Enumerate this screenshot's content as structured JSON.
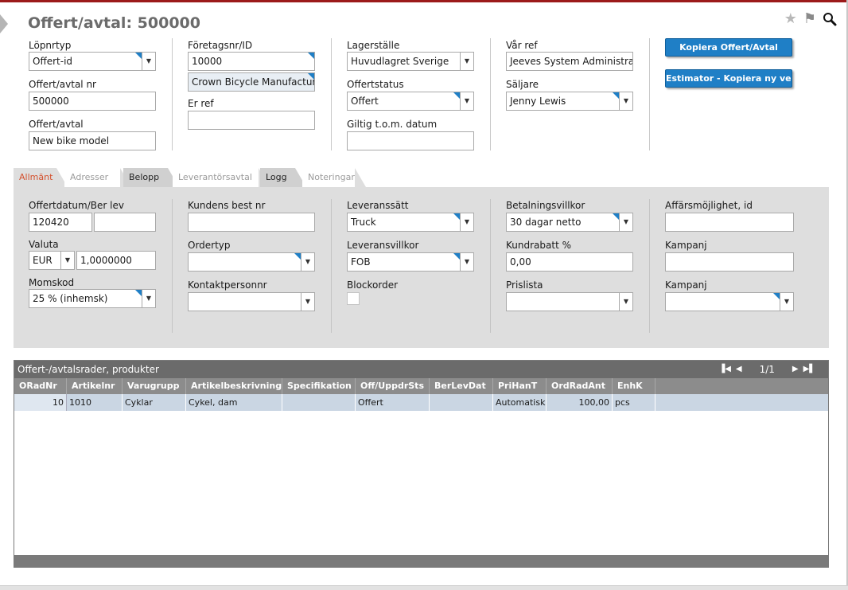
{
  "header": {
    "title": "Offert/avtal: 500000",
    "icons": [
      "star-icon",
      "flag-icon",
      "search-icon"
    ]
  },
  "top": {
    "lopnrtyp_label": "Löpnrtyp",
    "lopnrtyp_value": "Offert-id",
    "nr_label": "Offert/avtal nr",
    "nr_value": "500000",
    "offert_label": "Offert/avtal",
    "offert_value": "New bike model",
    "foretag_label": "Företagsnr/ID",
    "foretag_value": "10000",
    "foretag_name": "Crown Bicycle Manufacture",
    "erref_label": "Er ref",
    "erref_value": "",
    "lager_label": "Lagerställe",
    "lager_value": "Huvudlagret Sverige",
    "status_label": "Offertstatus",
    "status_value": "Offert",
    "giltig_label": "Giltig t.o.m. datum",
    "giltig_value": "",
    "varref_label": "Vår ref",
    "varref_value": "Jeeves System Administrato",
    "saljare_label": "Säljare",
    "saljare_value": "Jenny Lewis",
    "btn_kopiera": "Kopiera Offert/Avtal",
    "btn_estimator": "Estimator - Kopiera ny version"
  },
  "tabs": [
    "Allmänt",
    "Adresser",
    "Belopp",
    "Leverantörsavtal",
    "Logg",
    "Noteringar"
  ],
  "general": {
    "offertdatum_label": "Offertdatum/Ber lev",
    "offertdatum_value": "120420",
    "berlev_value": "",
    "valuta_label": "Valuta",
    "valuta_value": "EUR",
    "kurs_value": "1,0000000",
    "momskod_label": "Momskod",
    "momskod_value": "25 % (inhemsk)",
    "kundbest_label": "Kundens best nr",
    "kundbest_value": "",
    "ordertyp_label": "Ordertyp",
    "ordertyp_value": "",
    "kontakt_label": "Kontaktpersonnr",
    "kontakt_value": "",
    "levsatt_label": "Leveranssätt",
    "levsatt_value": "Truck",
    "levvillkor_label": "Leveransvillkor",
    "levvillkor_value": "FOB",
    "blockorder_label": "Blockorder",
    "betvillkor_label": "Betalningsvillkor",
    "betvillkor_value": "30 dagar netto",
    "kundrabatt_label": "Kundrabatt %",
    "kundrabatt_value": "0,00",
    "prislista_label": "Prislista",
    "prislista_value": "",
    "affars_label": "Affärsmöjlighet, id",
    "affars_value": "",
    "kampanj1_label": "Kampanj",
    "kampanj1_value": "",
    "kampanj2_label": "Kampanj",
    "kampanj2_value": ""
  },
  "grid": {
    "title": "Offert-/avtalsrader, produkter",
    "page": "1/1",
    "columns": [
      "ORadNr",
      "Artikelnr",
      "Varugrupp",
      "Artikelbeskrivning",
      "Specifikation",
      "Off/UppdrSts",
      "BerLevDat",
      "PriHanT",
      "OrdRadAnt",
      "EnhK"
    ],
    "rows": [
      [
        "10",
        "1010",
        "Cyklar",
        "Cykel, dam",
        "",
        "Offert",
        "",
        "Automatisk",
        "100,00",
        "pcs"
      ]
    ]
  }
}
